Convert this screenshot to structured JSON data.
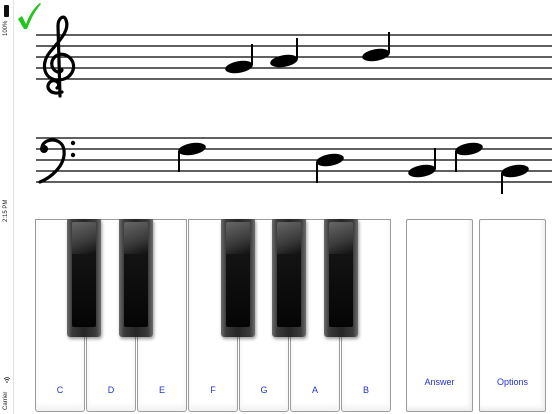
{
  "status_bar": {
    "battery": "100%",
    "time": "2:15 PM",
    "carrier": "Carrier"
  },
  "feedback": {
    "icon": "check-icon",
    "color": "#22c41e"
  },
  "treble_staff": {
    "clef": "treble-clef-icon",
    "note_count": 3
  },
  "bass_staff": {
    "clef": "bass-clef-icon",
    "note_count": 5
  },
  "keyboard": {
    "white_keys": [
      "C",
      "D",
      "E",
      "F",
      "G",
      "A",
      "B"
    ],
    "black_key_count": 5
  },
  "buttons": {
    "answer": "Answer",
    "options": "Options"
  },
  "colors": {
    "label_blue": "#2233cc",
    "check_green": "#22c41e"
  }
}
